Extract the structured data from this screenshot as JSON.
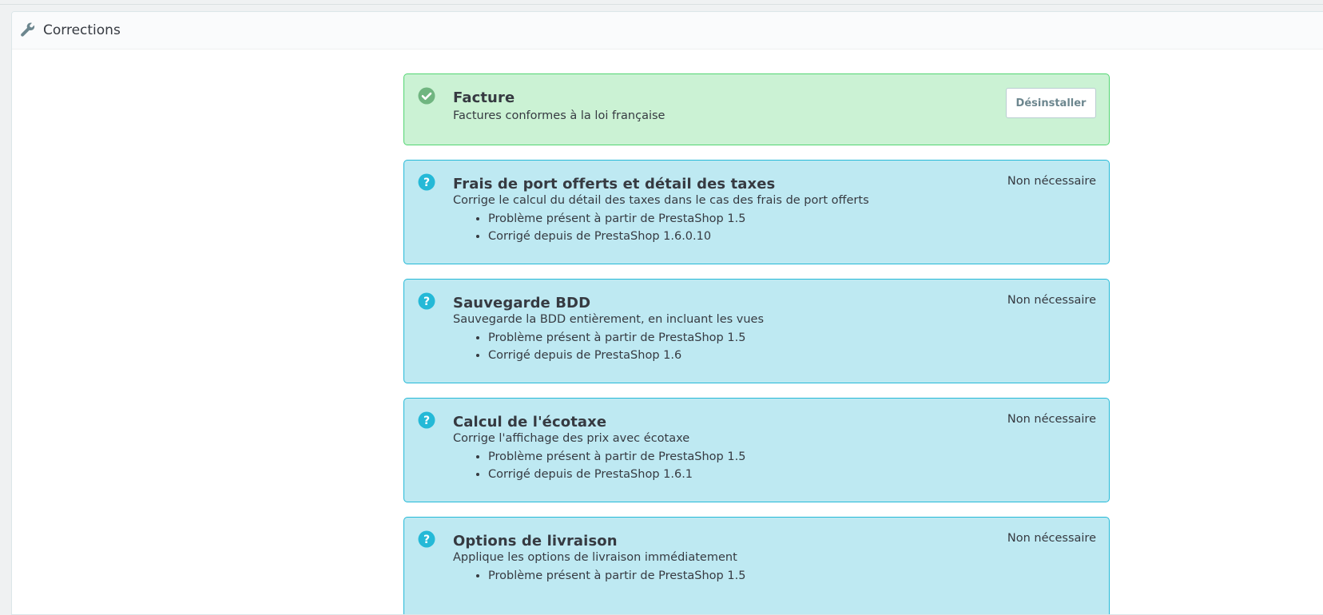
{
  "panel": {
    "title": "Corrections",
    "icon": "wrench-icon"
  },
  "colors": {
    "success_bg": "#cbf2d4",
    "success_border": "#53d572",
    "success_icon": "#70b580",
    "info_bg": "#bee9f2",
    "info_border": "#25b9d7",
    "info_icon": "#25b9d7"
  },
  "fixes": [
    {
      "status": "success",
      "icon": "check-circle-icon",
      "title": "Facture",
      "description": "Factures conformes à la loi française",
      "action_label": "Désinstaller",
      "bullets": []
    },
    {
      "status": "info",
      "icon": "question-circle-icon",
      "title": "Frais de port offerts et détail des taxes",
      "description": "Corrige le calcul du détail des taxes dans le cas des frais de port offerts",
      "state": "Non nécessaire",
      "bullets": [
        "Problème présent à partir de PrestaShop 1.5",
        "Corrigé depuis de PrestaShop 1.6.0.10"
      ]
    },
    {
      "status": "info",
      "icon": "question-circle-icon",
      "title": "Sauvegarde BDD",
      "description": "Sauvegarde la BDD entièrement, en incluant les vues",
      "state": "Non nécessaire",
      "bullets": [
        "Problème présent à partir de PrestaShop 1.5",
        "Corrigé depuis de PrestaShop 1.6"
      ]
    },
    {
      "status": "info",
      "icon": "question-circle-icon",
      "title": "Calcul de l'écotaxe",
      "description": "Corrige l'affichage des prix avec écotaxe",
      "state": "Non nécessaire",
      "bullets": [
        "Problème présent à partir de PrestaShop 1.5",
        "Corrigé depuis de PrestaShop 1.6.1"
      ]
    },
    {
      "status": "info",
      "icon": "question-circle-icon",
      "title": "Options de livraison",
      "description": "Applique les options de livraison immédiatement",
      "state": "Non nécessaire",
      "bullets": [
        "Problème présent à partir de PrestaShop 1.5"
      ]
    }
  ]
}
